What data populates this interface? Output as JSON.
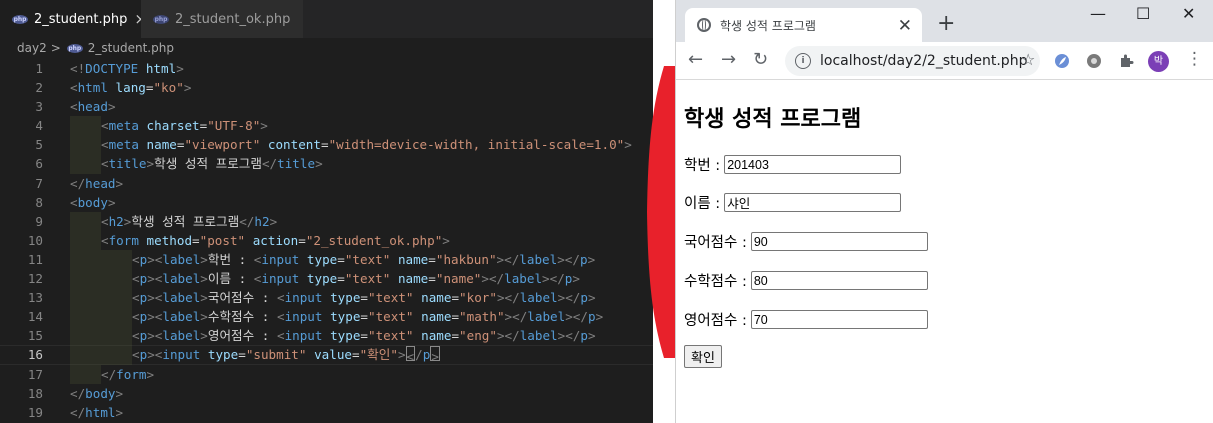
{
  "editor": {
    "tabs": [
      {
        "label": "2_student.php",
        "icon": "php-file-icon",
        "active": true
      },
      {
        "label": "2_student_ok.php",
        "icon": "php-file-icon",
        "active": false
      }
    ],
    "php_badge": "php",
    "close_glyph": "×",
    "breadcrumb": {
      "folder": "day2",
      "separator": ">",
      "file": "2_student.php"
    },
    "line_numbers": [
      "1",
      "2",
      "3",
      "4",
      "5",
      "6",
      "7",
      "8",
      "9",
      "10",
      "11",
      "12",
      "13",
      "14",
      "15",
      "16",
      "17",
      "18",
      "19"
    ],
    "current_line": "16",
    "code": {
      "l2_lang": "\"ko\"",
      "l4_charset": "\"UTF-8\"",
      "l5_name": "\"viewport\"",
      "l5_content": "\"width=device-width, initial-scale=1.0\"",
      "l6_title": "학생 성적 프로그램",
      "l9_h2": "학생 성적 프로그램",
      "l10_method": "\"post\"",
      "l10_action": "\"2_student_ok.php\"",
      "fields": [
        {
          "label": "학번 : ",
          "name": "\"hakbun\""
        },
        {
          "label": "이름 : ",
          "name": "\"name\""
        },
        {
          "label": "국어점수 : ",
          "name": "\"kor\""
        },
        {
          "label": "수학점수 : ",
          "name": "\"math\""
        },
        {
          "label": "영어점수 : ",
          "name": "\"eng\""
        }
      ],
      "type_text": "\"text\"",
      "l16_type": "\"submit\"",
      "l16_value": "\"확인\""
    }
  },
  "browser": {
    "tab_title": "학생 성적 프로그램",
    "tab_close": "✕",
    "new_tab": "+",
    "window_controls": {
      "minimize": "—",
      "maximize": "☐",
      "close": "✕"
    },
    "nav": {
      "back": "←",
      "forward": "→",
      "reload": "↻"
    },
    "info": "i",
    "url": "localhost/day2/2_student.php",
    "star": "☆",
    "profile_initial": "박",
    "menu": "⋮",
    "page": {
      "heading": "학생 성적 프로그램",
      "fields": [
        {
          "label": "학번 :",
          "value": "201403"
        },
        {
          "label": "이름 :",
          "value": "샤인"
        },
        {
          "label": "국어점수 :",
          "value": "90"
        },
        {
          "label": "수학점수 :",
          "value": "80"
        },
        {
          "label": "영어점수 :",
          "value": "70"
        }
      ],
      "submit_label": "확인"
    }
  },
  "colors": {
    "editor_bg": "#1e1e1e",
    "tag": "#569cd6",
    "attribute": "#9cdcfe",
    "string": "#ce9178",
    "arrow": "#e8212b"
  }
}
